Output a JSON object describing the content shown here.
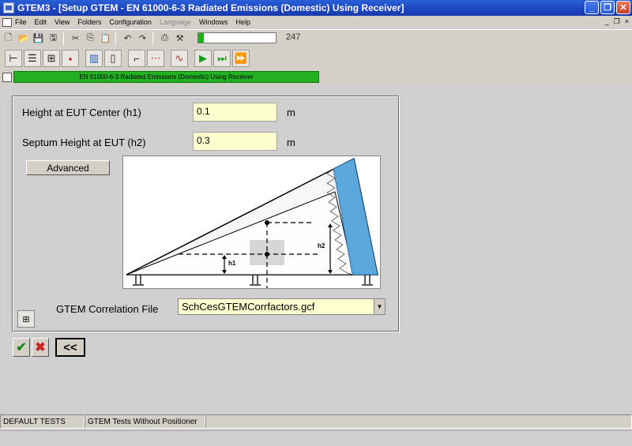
{
  "window": {
    "title": "GTEM3 - [Setup GTEM - EN 61000-6-3 Radiated Emissions (Domestic) Using Receiver]",
    "minimize_icon": "minimize-icon",
    "maximize_icon": "restore-icon",
    "close_icon": "close-icon"
  },
  "menu": {
    "items": [
      "File",
      "Edit",
      "View",
      "Folders",
      "Configuration",
      "Language",
      "Windows",
      "Help"
    ],
    "mdi_buttons": [
      "_",
      "×"
    ]
  },
  "toolbar": {
    "progress_fraction": 0.07,
    "counter": "247"
  },
  "document": {
    "bar_label": "EN 61000-6-3 Radiated Emissions (Domestic) Using Receiver"
  },
  "form": {
    "h1_label": "Height at EUT Center (h1)",
    "h1_value": "0.1",
    "h1_unit": "m",
    "h2_label": "Septum Height at EUT (h2)",
    "h2_value": "0.3",
    "h2_unit": "m",
    "advanced_label": "Advanced",
    "diagram_h1": "h1",
    "diagram_h2": "h2",
    "correlation_label": "GTEM Correlation File",
    "correlation_value": "SchCesGTEMCorrfactors.gcf"
  },
  "actions": {
    "back_label": "<<"
  },
  "status": {
    "left": "DEFAULT TESTS",
    "right": "GTEM Tests Without Positioner"
  },
  "colors": {
    "accent_green": "#23b023",
    "field_bg": "#ffffcf",
    "absorber_blue": "#5aa7dc"
  }
}
